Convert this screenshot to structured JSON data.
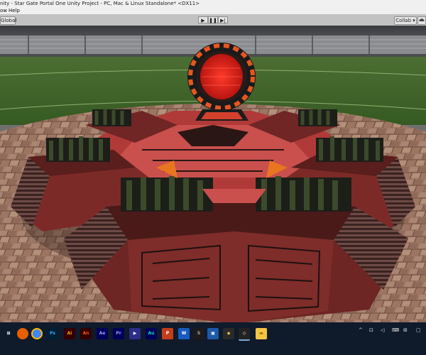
{
  "window": {
    "title": "nity - Star Gate Portal One Unity Project - PC, Mac & Linux Standalone* <DX11>"
  },
  "menu": {
    "items": [
      "ow",
      "Help"
    ]
  },
  "toolbar": {
    "global_label": "Global",
    "play_icon": "▶",
    "pause_icon": "❚❚",
    "step_icon": "▶|",
    "collab_label": "Collab ▾",
    "cloud_icon": "cloud-icon"
  },
  "taskbar": {
    "apps": [
      {
        "name": "firefox",
        "label": "",
        "color": "#e66000"
      },
      {
        "name": "chrome",
        "label": "",
        "color": "#4285f4"
      },
      {
        "name": "photoshop",
        "label": "Ps",
        "color": "#001e36",
        "fg": "#31a8ff"
      },
      {
        "name": "illustrator",
        "label": "Ai",
        "color": "#330000",
        "fg": "#ff9a00"
      },
      {
        "name": "animate",
        "label": "An",
        "color": "#330000",
        "fg": "#ff4f1a"
      },
      {
        "name": "after-effects",
        "label": "Ae",
        "color": "#00005b",
        "fg": "#9999ff"
      },
      {
        "name": "premiere",
        "label": "Pr",
        "color": "#00005b",
        "fg": "#9999ff"
      },
      {
        "name": "media-player",
        "label": "▶",
        "color": "#2d2d8a",
        "fg": "#ffffff"
      },
      {
        "name": "audition",
        "label": "Au",
        "color": "#00005b",
        "fg": "#00e4bb"
      },
      {
        "name": "powerpoint",
        "label": "P",
        "color": "#c43e1c",
        "fg": "#ffffff"
      },
      {
        "name": "word",
        "label": "W",
        "color": "#185abd",
        "fg": "#ffffff"
      },
      {
        "name": "substance",
        "label": "S",
        "color": "#1c1c1c",
        "fg": "#aaaaaa"
      },
      {
        "name": "photos",
        "label": "▣",
        "color": "#1c5aa8",
        "fg": "#ffffff"
      },
      {
        "name": "app-cube",
        "label": "◆",
        "color": "#2a2a2a",
        "fg": "#e0c050"
      },
      {
        "name": "unity",
        "label": "◇",
        "color": "#222222",
        "fg": "#ffffff"
      },
      {
        "name": "file-explorer",
        "label": "▬",
        "color": "#f5c542",
        "fg": "#8a6500"
      }
    ],
    "tray": [
      "^",
      "⊡",
      "◁",
      "⌨",
      "⊞",
      "▢"
    ]
  }
}
